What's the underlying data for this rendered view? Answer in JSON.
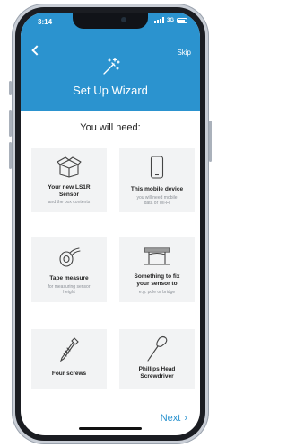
{
  "status_bar": {
    "time": "3:14",
    "network": "3G"
  },
  "header": {
    "back_icon": "chevron-left-icon",
    "skip_label": "Skip",
    "wand_icon": "magic-wand-icon",
    "title": "Set Up Wizard"
  },
  "main": {
    "subtitle": "You will need:",
    "items": [
      {
        "icon": "box-icon",
        "name_lines": [
          "Your new LS1R",
          "Sensor"
        ],
        "desc_lines": [
          "and the box contents"
        ]
      },
      {
        "icon": "mobile-device-icon",
        "name_lines": [
          "This mobile device"
        ],
        "desc_lines": [
          "you will need mobile",
          "data or Wi-Fi"
        ]
      },
      {
        "icon": "tape-measure-icon",
        "name_lines": [
          "Tape measure"
        ],
        "desc_lines": [
          "for measuring sensor",
          "height"
        ]
      },
      {
        "icon": "bridge-icon",
        "name_lines": [
          "Something to fix",
          "your sensor to"
        ],
        "desc_lines": [
          "e.g. pole or bridge"
        ]
      },
      {
        "icon": "screw-icon",
        "name_lines": [
          "Four screws"
        ],
        "desc_lines": []
      },
      {
        "icon": "screwdriver-icon",
        "name_lines": [
          "Phillips Head",
          "Screwdriver"
        ],
        "desc_lines": []
      }
    ]
  },
  "footer": {
    "next_label": "Next",
    "next_icon": "chevron-right-icon"
  },
  "colors": {
    "brand_blue": "#2b93cf",
    "card_bg": "#f2f3f4"
  }
}
